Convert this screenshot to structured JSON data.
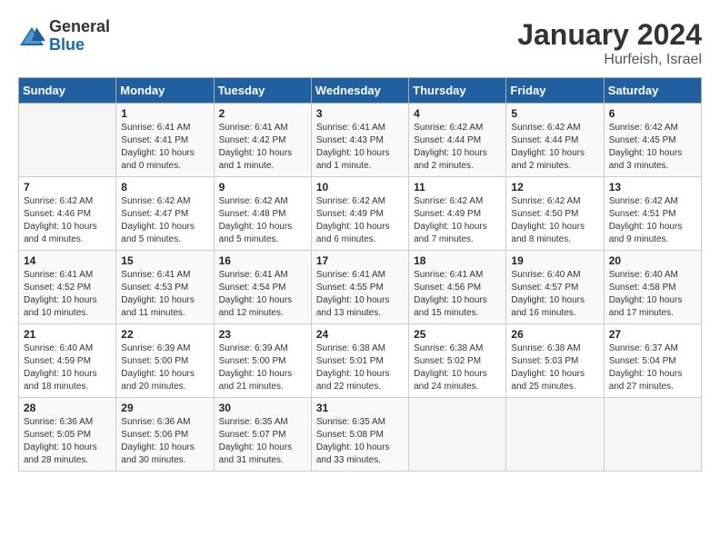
{
  "header": {
    "logo_general": "General",
    "logo_blue": "Blue",
    "month_title": "January 2024",
    "location": "Hurfeish, Israel"
  },
  "days_of_week": [
    "Sunday",
    "Monday",
    "Tuesday",
    "Wednesday",
    "Thursday",
    "Friday",
    "Saturday"
  ],
  "weeks": [
    [
      {
        "day": "",
        "info": ""
      },
      {
        "day": "1",
        "info": "Sunrise: 6:41 AM\nSunset: 4:41 PM\nDaylight: 10 hours\nand 0 minutes."
      },
      {
        "day": "2",
        "info": "Sunrise: 6:41 AM\nSunset: 4:42 PM\nDaylight: 10 hours\nand 1 minute."
      },
      {
        "day": "3",
        "info": "Sunrise: 6:41 AM\nSunset: 4:43 PM\nDaylight: 10 hours\nand 1 minute."
      },
      {
        "day": "4",
        "info": "Sunrise: 6:42 AM\nSunset: 4:44 PM\nDaylight: 10 hours\nand 2 minutes."
      },
      {
        "day": "5",
        "info": "Sunrise: 6:42 AM\nSunset: 4:44 PM\nDaylight: 10 hours\nand 2 minutes."
      },
      {
        "day": "6",
        "info": "Sunrise: 6:42 AM\nSunset: 4:45 PM\nDaylight: 10 hours\nand 3 minutes."
      }
    ],
    [
      {
        "day": "7",
        "info": "Sunrise: 6:42 AM\nSunset: 4:46 PM\nDaylight: 10 hours\nand 4 minutes."
      },
      {
        "day": "8",
        "info": "Sunrise: 6:42 AM\nSunset: 4:47 PM\nDaylight: 10 hours\nand 5 minutes."
      },
      {
        "day": "9",
        "info": "Sunrise: 6:42 AM\nSunset: 4:48 PM\nDaylight: 10 hours\nand 5 minutes."
      },
      {
        "day": "10",
        "info": "Sunrise: 6:42 AM\nSunset: 4:49 PM\nDaylight: 10 hours\nand 6 minutes."
      },
      {
        "day": "11",
        "info": "Sunrise: 6:42 AM\nSunset: 4:49 PM\nDaylight: 10 hours\nand 7 minutes."
      },
      {
        "day": "12",
        "info": "Sunrise: 6:42 AM\nSunset: 4:50 PM\nDaylight: 10 hours\nand 8 minutes."
      },
      {
        "day": "13",
        "info": "Sunrise: 6:42 AM\nSunset: 4:51 PM\nDaylight: 10 hours\nand 9 minutes."
      }
    ],
    [
      {
        "day": "14",
        "info": "Sunrise: 6:41 AM\nSunset: 4:52 PM\nDaylight: 10 hours\nand 10 minutes."
      },
      {
        "day": "15",
        "info": "Sunrise: 6:41 AM\nSunset: 4:53 PM\nDaylight: 10 hours\nand 11 minutes."
      },
      {
        "day": "16",
        "info": "Sunrise: 6:41 AM\nSunset: 4:54 PM\nDaylight: 10 hours\nand 12 minutes."
      },
      {
        "day": "17",
        "info": "Sunrise: 6:41 AM\nSunset: 4:55 PM\nDaylight: 10 hours\nand 13 minutes."
      },
      {
        "day": "18",
        "info": "Sunrise: 6:41 AM\nSunset: 4:56 PM\nDaylight: 10 hours\nand 15 minutes."
      },
      {
        "day": "19",
        "info": "Sunrise: 6:40 AM\nSunset: 4:57 PM\nDaylight: 10 hours\nand 16 minutes."
      },
      {
        "day": "20",
        "info": "Sunrise: 6:40 AM\nSunset: 4:58 PM\nDaylight: 10 hours\nand 17 minutes."
      }
    ],
    [
      {
        "day": "21",
        "info": "Sunrise: 6:40 AM\nSunset: 4:59 PM\nDaylight: 10 hours\nand 18 minutes."
      },
      {
        "day": "22",
        "info": "Sunrise: 6:39 AM\nSunset: 5:00 PM\nDaylight: 10 hours\nand 20 minutes."
      },
      {
        "day": "23",
        "info": "Sunrise: 6:39 AM\nSunset: 5:00 PM\nDaylight: 10 hours\nand 21 minutes."
      },
      {
        "day": "24",
        "info": "Sunrise: 6:38 AM\nSunset: 5:01 PM\nDaylight: 10 hours\nand 22 minutes."
      },
      {
        "day": "25",
        "info": "Sunrise: 6:38 AM\nSunset: 5:02 PM\nDaylight: 10 hours\nand 24 minutes."
      },
      {
        "day": "26",
        "info": "Sunrise: 6:38 AM\nSunset: 5:03 PM\nDaylight: 10 hours\nand 25 minutes."
      },
      {
        "day": "27",
        "info": "Sunrise: 6:37 AM\nSunset: 5:04 PM\nDaylight: 10 hours\nand 27 minutes."
      }
    ],
    [
      {
        "day": "28",
        "info": "Sunrise: 6:36 AM\nSunset: 5:05 PM\nDaylight: 10 hours\nand 28 minutes."
      },
      {
        "day": "29",
        "info": "Sunrise: 6:36 AM\nSunset: 5:06 PM\nDaylight: 10 hours\nand 30 minutes."
      },
      {
        "day": "30",
        "info": "Sunrise: 6:35 AM\nSunset: 5:07 PM\nDaylight: 10 hours\nand 31 minutes."
      },
      {
        "day": "31",
        "info": "Sunrise: 6:35 AM\nSunset: 5:08 PM\nDaylight: 10 hours\nand 33 minutes."
      },
      {
        "day": "",
        "info": ""
      },
      {
        "day": "",
        "info": ""
      },
      {
        "day": "",
        "info": ""
      }
    ]
  ]
}
